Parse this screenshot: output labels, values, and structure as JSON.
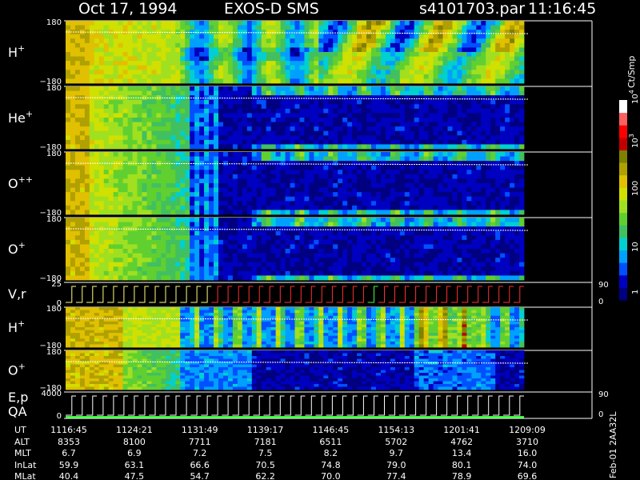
{
  "title": {
    "date": "Oct 17, 1994",
    "instrument": "EXOS-D SMS",
    "file": "s4101703.par",
    "time": "11:16:45"
  },
  "colorbar": {
    "unit": "Ct/Smp",
    "tick_labels": [
      "1",
      "10",
      "100",
      "10",
      "10"
    ],
    "tick_exponents": [
      "",
      "",
      "",
      "3",
      "4"
    ],
    "colors": [
      "#000080",
      "#0000c0",
      "#0050ff",
      "#00a0ff",
      "#00d0d0",
      "#40c060",
      "#60d030",
      "#a0e020",
      "#d0e000",
      "#e0c000",
      "#b0a000",
      "#808000",
      "#c00000",
      "#ff0000",
      "#ff6060",
      "#ffffff"
    ]
  },
  "panels": [
    {
      "id": "h-plus",
      "label": "H",
      "sup": "+",
      "ymax": "180",
      "ymin": "−180",
      "kind": "spectrogram"
    },
    {
      "id": "he-plus",
      "label": "He",
      "sup": "+",
      "ymax": "180",
      "ymin": "−180",
      "kind": "spectrogram"
    },
    {
      "id": "o-plusplus",
      "label": "O",
      "sup": "++",
      "ymax": "180",
      "ymin": "−180",
      "kind": "spectrogram"
    },
    {
      "id": "o-plus",
      "label": "O",
      "sup": "+",
      "ymax": "180",
      "ymin": "−180",
      "kind": "spectrogram"
    },
    {
      "id": "vr",
      "label": "V,r",
      "sup": "",
      "ymax": "25",
      "ymin": "0",
      "right_max": "90",
      "right_min": "0",
      "kind": "line"
    },
    {
      "id": "h-plus-2",
      "label": "H",
      "sup": "+",
      "ymax": "180",
      "ymin": "−180",
      "kind": "spectrogram"
    },
    {
      "id": "o-plus-2",
      "label": "O",
      "sup": "+",
      "ymax": "180",
      "ymin": "−180",
      "kind": "spectrogram"
    },
    {
      "id": "ep-qa",
      "label": "E,p",
      "label2": "QA",
      "sup": "",
      "ymax": "4000",
      "ymin": "0",
      "right_max": "90",
      "right_min": "0",
      "kind": "line"
    }
  ],
  "side_label": "Feb-01 2AA32L",
  "ephemeris": {
    "row_labels": [
      "UT",
      "ALT",
      "MLT",
      "InLat",
      "MLat"
    ],
    "columns": [
      [
        "1116:45",
        "8353",
        "6.7",
        "59.9",
        "40.4"
      ],
      [
        "1124:21",
        "8100",
        "6.9",
        "63.1",
        "47.5"
      ],
      [
        "1131:49",
        "7711",
        "7.2",
        "66.6",
        "54.7"
      ],
      [
        "1139:17",
        "7181",
        "7.5",
        "70.5",
        "62.2"
      ],
      [
        "1146:45",
        "6511",
        "8.2",
        "74.8",
        "70.0"
      ],
      [
        "1154:13",
        "5702",
        "9.7",
        "79.0",
        "77.4"
      ],
      [
        "1201:41",
        "4762",
        "13.4",
        "80.1",
        "78.9"
      ],
      [
        "1209:09",
        "3710",
        "16.0",
        "74.0",
        "69.6"
      ]
    ]
  },
  "chart_data": {
    "type": "heatmap",
    "x_tick_labels": [
      "1116:45",
      "1124:21",
      "1131:49",
      "1139:17",
      "1146:45",
      "1154:13",
      "1201:41",
      "1209:09"
    ],
    "y_range": [
      -180,
      180
    ],
    "color_scale": "log",
    "color_range": [
      1,
      10000
    ],
    "color_label": "Ct/Smp",
    "series": [
      {
        "name": "H+"
      },
      {
        "name": "He+"
      },
      {
        "name": "O++"
      },
      {
        "name": "O+"
      },
      {
        "name": "V,r",
        "ylim": [
          0,
          25
        ],
        "ylim_right": [
          0,
          90
        ]
      },
      {
        "name": "H+"
      },
      {
        "name": "O+"
      },
      {
        "name": "E,p / QA",
        "ylim": [
          0,
          4000
        ],
        "ylim_right": [
          0,
          90
        ]
      }
    ]
  }
}
